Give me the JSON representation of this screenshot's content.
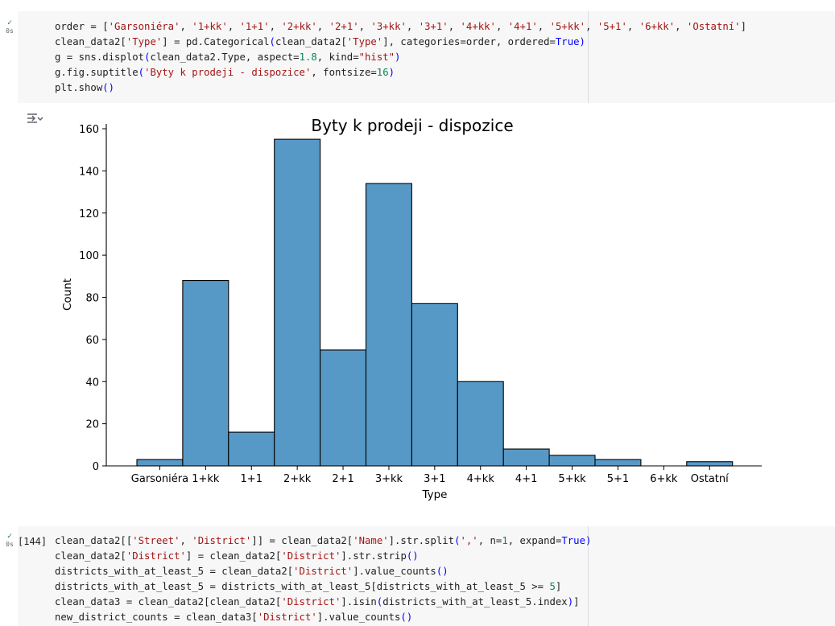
{
  "cell1": {
    "status_time": "0s",
    "code": [
      "order = ['Garsoniéra', '1+kk', '1+1', '2+kk', '2+1', '3+kk', '3+1', '4+kk', '4+1', '5+kk', '5+1', '6+kk', 'Ostatní']",
      "clean_data2['Type'] = pd.Categorical(clean_data2['Type'], categories=order, ordered=True)",
      "g = sns.displot(clean_data2.Type, aspect=1.8, kind=\"hist\")",
      "g.fig.suptitle('Byty k prodeji - dispozice', fontsize=16)",
      "plt.show()"
    ]
  },
  "output_icon": "output-toggle-icon",
  "chart_data": {
    "type": "bar",
    "title": "Byty k prodeji - dispozice",
    "xlabel": "Type",
    "ylabel": "Count",
    "categories": [
      "Garsoniéra",
      "1+kk",
      "1+1",
      "2+kk",
      "2+1",
      "3+kk",
      "3+1",
      "4+kk",
      "4+1",
      "5+kk",
      "5+1",
      "6+kk",
      "Ostatní"
    ],
    "values": [
      3,
      88,
      16,
      155,
      55,
      134,
      77,
      40,
      8,
      5,
      3,
      0,
      2
    ],
    "yticks": [
      "0",
      "20",
      "40",
      "60",
      "80",
      "100",
      "120",
      "140",
      "160"
    ],
    "ylim": [
      0,
      160
    ],
    "bar_color": "#5799c6",
    "grid": false
  },
  "cell2": {
    "exec_count": "[144]",
    "status_time": "0s",
    "code": [
      "clean_data2[['Street', 'District']] = clean_data2['Name'].str.split(',', n=1, expand=True)",
      "clean_data2['District'] = clean_data2['District'].str.strip()",
      "districts_with_at_least_5 = clean_data2['District'].value_counts()",
      "districts_with_at_least_5 = districts_with_at_least_5[districts_with_at_least_5 >= 5]",
      "clean_data3 = clean_data2[clean_data2['District'].isin(districts_with_at_least_5.index)]",
      "new_district_counts = clean_data3['District'].value_counts()"
    ]
  },
  "colors": {
    "string": "#a31515",
    "keyword": "#0000ff",
    "number": "#098658",
    "success": "#188038"
  }
}
